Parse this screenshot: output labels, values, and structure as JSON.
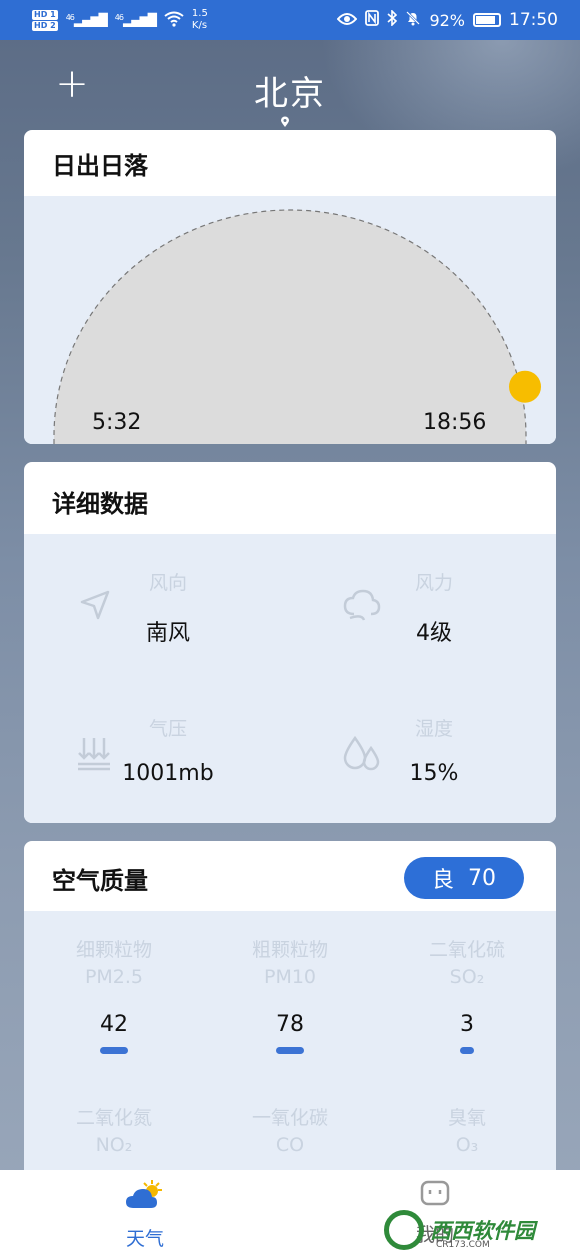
{
  "status_bar": {
    "hd1": "HD 1",
    "hd2": "HD 2",
    "sig1": "46",
    "sig2": "46",
    "speed_value": "1.5",
    "speed_unit": "K/s",
    "battery": "92%",
    "time": "17:50"
  },
  "header": {
    "add_symbol": "+",
    "city": "北京"
  },
  "sun": {
    "title": "日出日落",
    "sunrise": "5:32",
    "sunset": "18:56",
    "progress": 0.97,
    "sun_color": "#f7bd00"
  },
  "details": {
    "title": "详细数据",
    "items": [
      {
        "label": "风向",
        "value": "南风",
        "icon": "navigation-arrow-icon"
      },
      {
        "label": "风力",
        "value": "4级",
        "icon": "wind-swirl-icon"
      },
      {
        "label": "气压",
        "value": "1001mb",
        "icon": "pressure-arrows-icon"
      },
      {
        "label": "湿度",
        "value": "15%",
        "icon": "water-drops-icon"
      }
    ]
  },
  "air": {
    "title": "空气质量",
    "badge_level": "良",
    "badge_value": "70",
    "accent": "#2d6fd7",
    "pollutants": [
      {
        "name": "细颗粒物",
        "symbol": "PM2.5",
        "value": "42"
      },
      {
        "name": "粗颗粒物",
        "symbol": "PM10",
        "value": "78"
      },
      {
        "name": "二氧化硫",
        "symbol": "SO₂",
        "value": "3"
      },
      {
        "name": "二氧化氮",
        "symbol": "NO₂",
        "value": ""
      },
      {
        "name": "一氧化碳",
        "symbol": "CO",
        "value": ""
      },
      {
        "name": "臭氧",
        "symbol": "O₃",
        "value": ""
      }
    ]
  },
  "nav": {
    "weather": "天气",
    "mine": "我的"
  },
  "watermark": {
    "text": "西西软件园",
    "url": "CR173.COM"
  }
}
